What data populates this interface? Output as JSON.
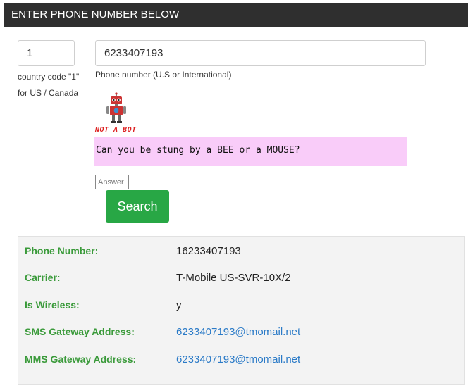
{
  "header": {
    "title": "ENTER PHONE NUMBER BELOW"
  },
  "form": {
    "country_code_value": "1",
    "country_code_help": "country code \"1\" for US / Canada",
    "phone_value": "6233407193",
    "phone_help": "Phone number (U.S or International)",
    "captcha_badge": "NOT A BOT",
    "captcha_question": "Can you be stung by a BEE or a MOUSE?",
    "answer_placeholder": "Answer",
    "search_label": "Search"
  },
  "results": {
    "rows": [
      {
        "label": "Phone Number:",
        "value": "16233407193"
      },
      {
        "label": "Carrier:",
        "value": "T-Mobile US-SVR-10X/2"
      },
      {
        "label": "Is Wireless:",
        "value": "y"
      },
      {
        "label": "SMS Gateway Address:",
        "value": "6233407193@tmomail.net"
      },
      {
        "label": "MMS Gateway Address:",
        "value": "6233407193@tmomail.net"
      }
    ]
  },
  "colors": {
    "header_bg": "#2f2f2f",
    "search_button": "#28a745",
    "result_label": "#3a9a3a",
    "link": "#2a7ac7",
    "captcha_bg": "#f9ccf9"
  },
  "icons": {
    "robot": "robot-icon"
  }
}
